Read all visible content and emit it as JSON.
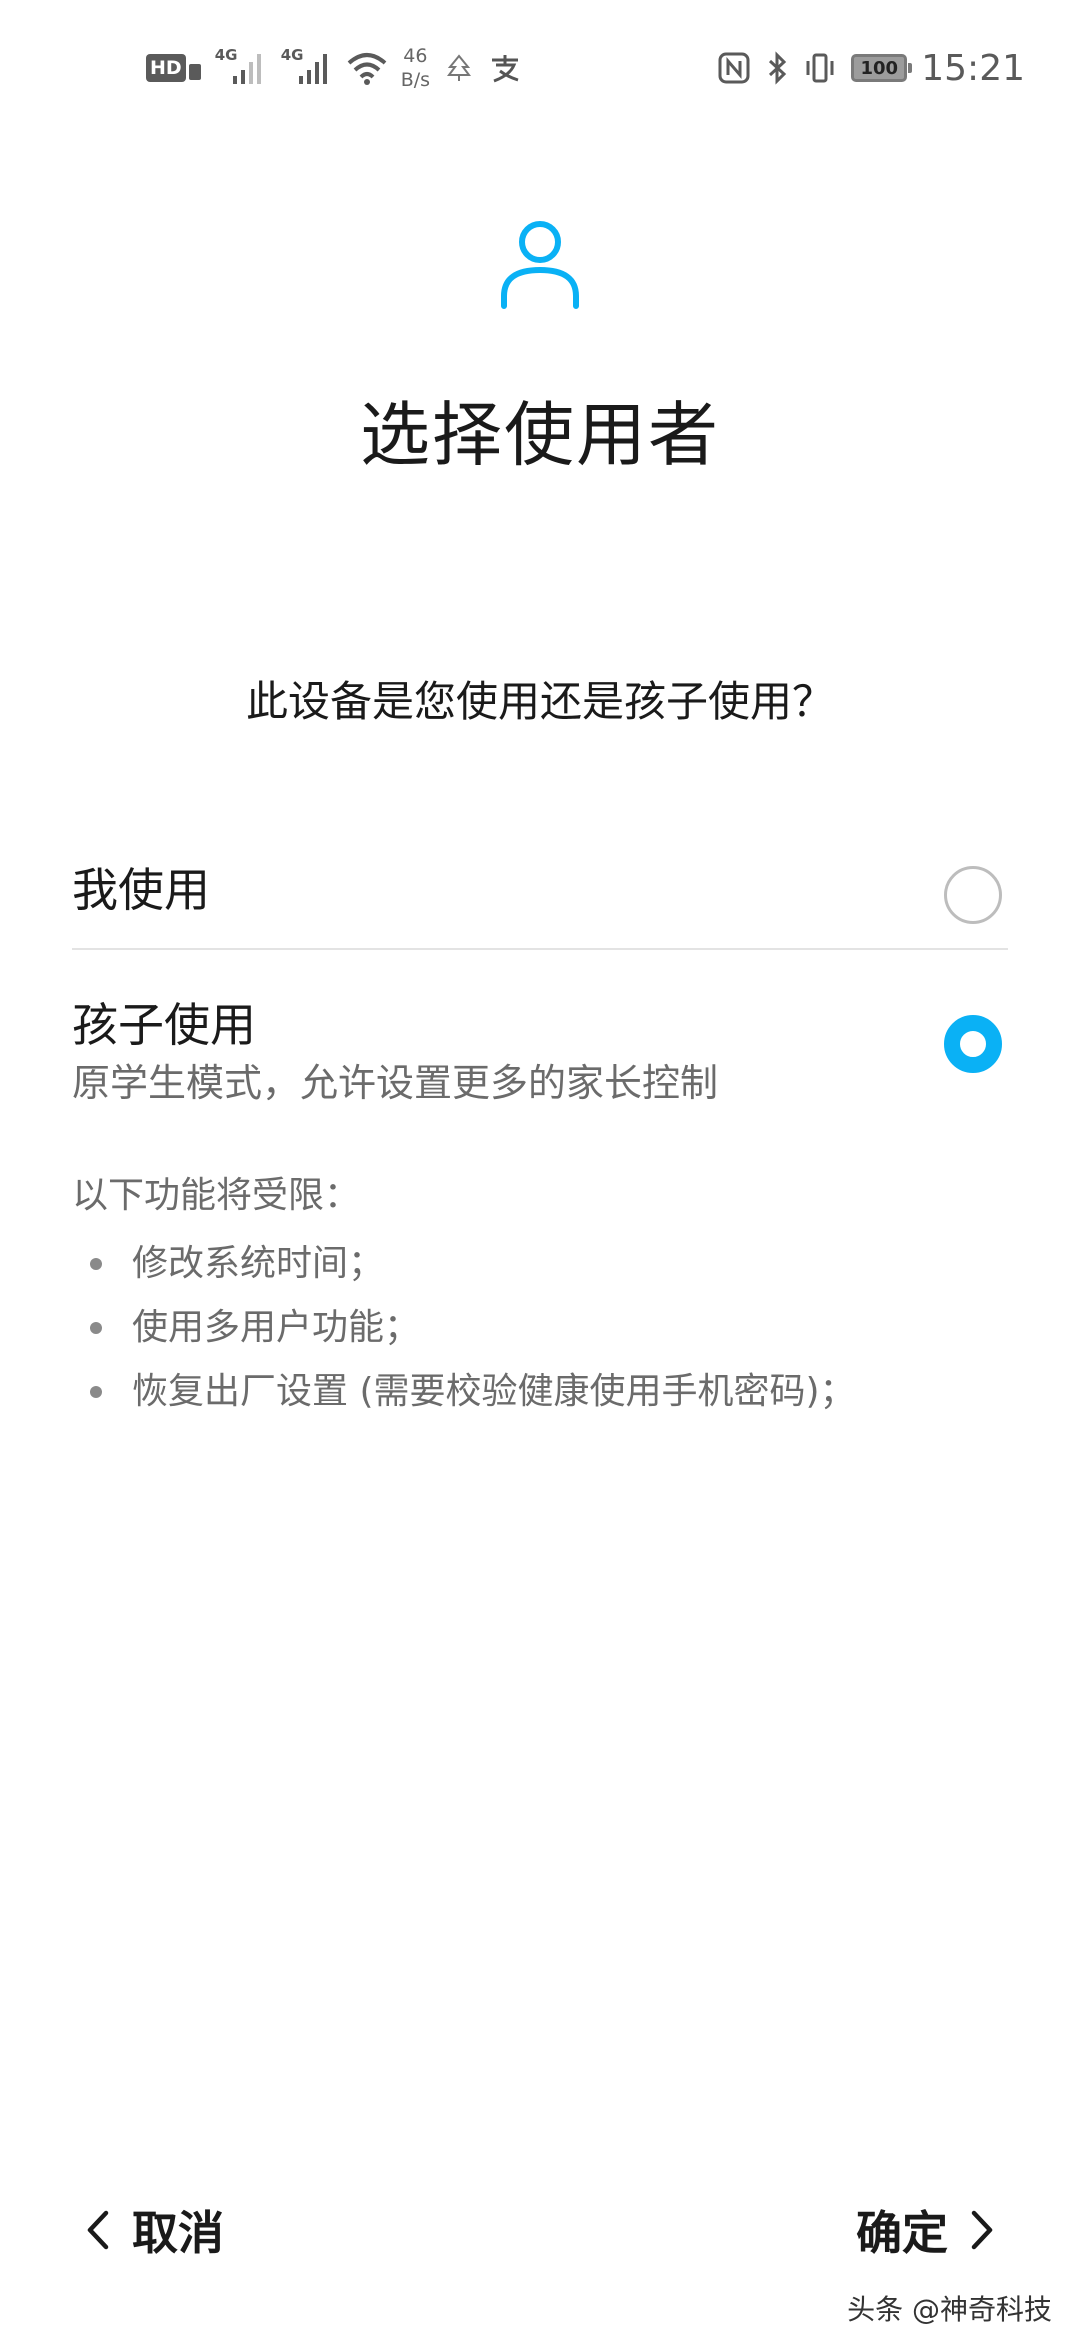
{
  "status_bar": {
    "hd_label": "HD",
    "signal1_label": "4G",
    "signal2_label": "4G",
    "speed_value": "46",
    "speed_unit": "B/s",
    "battery_level": "100",
    "time": "15:21",
    "left_icons": [
      "hd-volte-icon",
      "signal-icon",
      "signal-icon",
      "wifi-icon",
      "tree-icon",
      "alipay-icon"
    ],
    "right_icons": [
      "nfc-icon",
      "bluetooth-icon",
      "vibrate-icon",
      "battery-icon"
    ]
  },
  "header": {
    "icon": "user-icon",
    "title": "选择使用者",
    "accent_color": "#0ab1f5"
  },
  "question": "此设备是您使用还是孩子使用？",
  "options": [
    {
      "label": "我使用",
      "selected": false
    },
    {
      "label": "孩子使用",
      "description": "原学生模式，允许设置更多的家长控制",
      "selected": true
    }
  ],
  "restrictions": {
    "heading": "以下功能将受限：",
    "items": [
      "修改系统时间；",
      "使用多用户功能；",
      "恢复出厂设置 (需要校验健康使用手机密码)；"
    ]
  },
  "bottom_nav": {
    "cancel_label": "取消",
    "confirm_label": "确定"
  },
  "watermark": "头条 @神奇科技"
}
